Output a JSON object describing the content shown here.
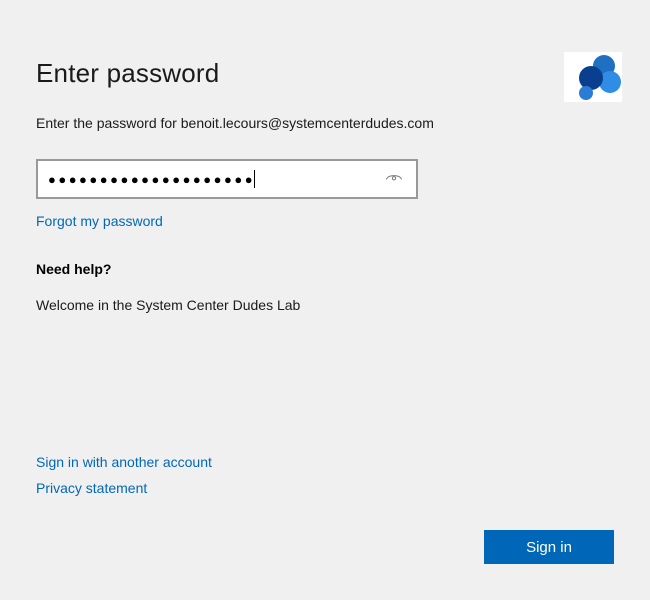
{
  "header": {
    "title": "Enter password"
  },
  "instruction": {
    "prefix": "Enter the password for ",
    "email": "benoit.lecours@systemcenterdudes.com"
  },
  "password": {
    "masked_value": "●●●●●●●●●●●●●●●●●●●●"
  },
  "links": {
    "forgot": "Forgot my password",
    "another_account": "Sign in with another account",
    "privacy": "Privacy statement"
  },
  "help": {
    "heading": "Need help?",
    "welcome": "Welcome in the System Center Dudes Lab"
  },
  "buttons": {
    "signin": "Sign in"
  }
}
